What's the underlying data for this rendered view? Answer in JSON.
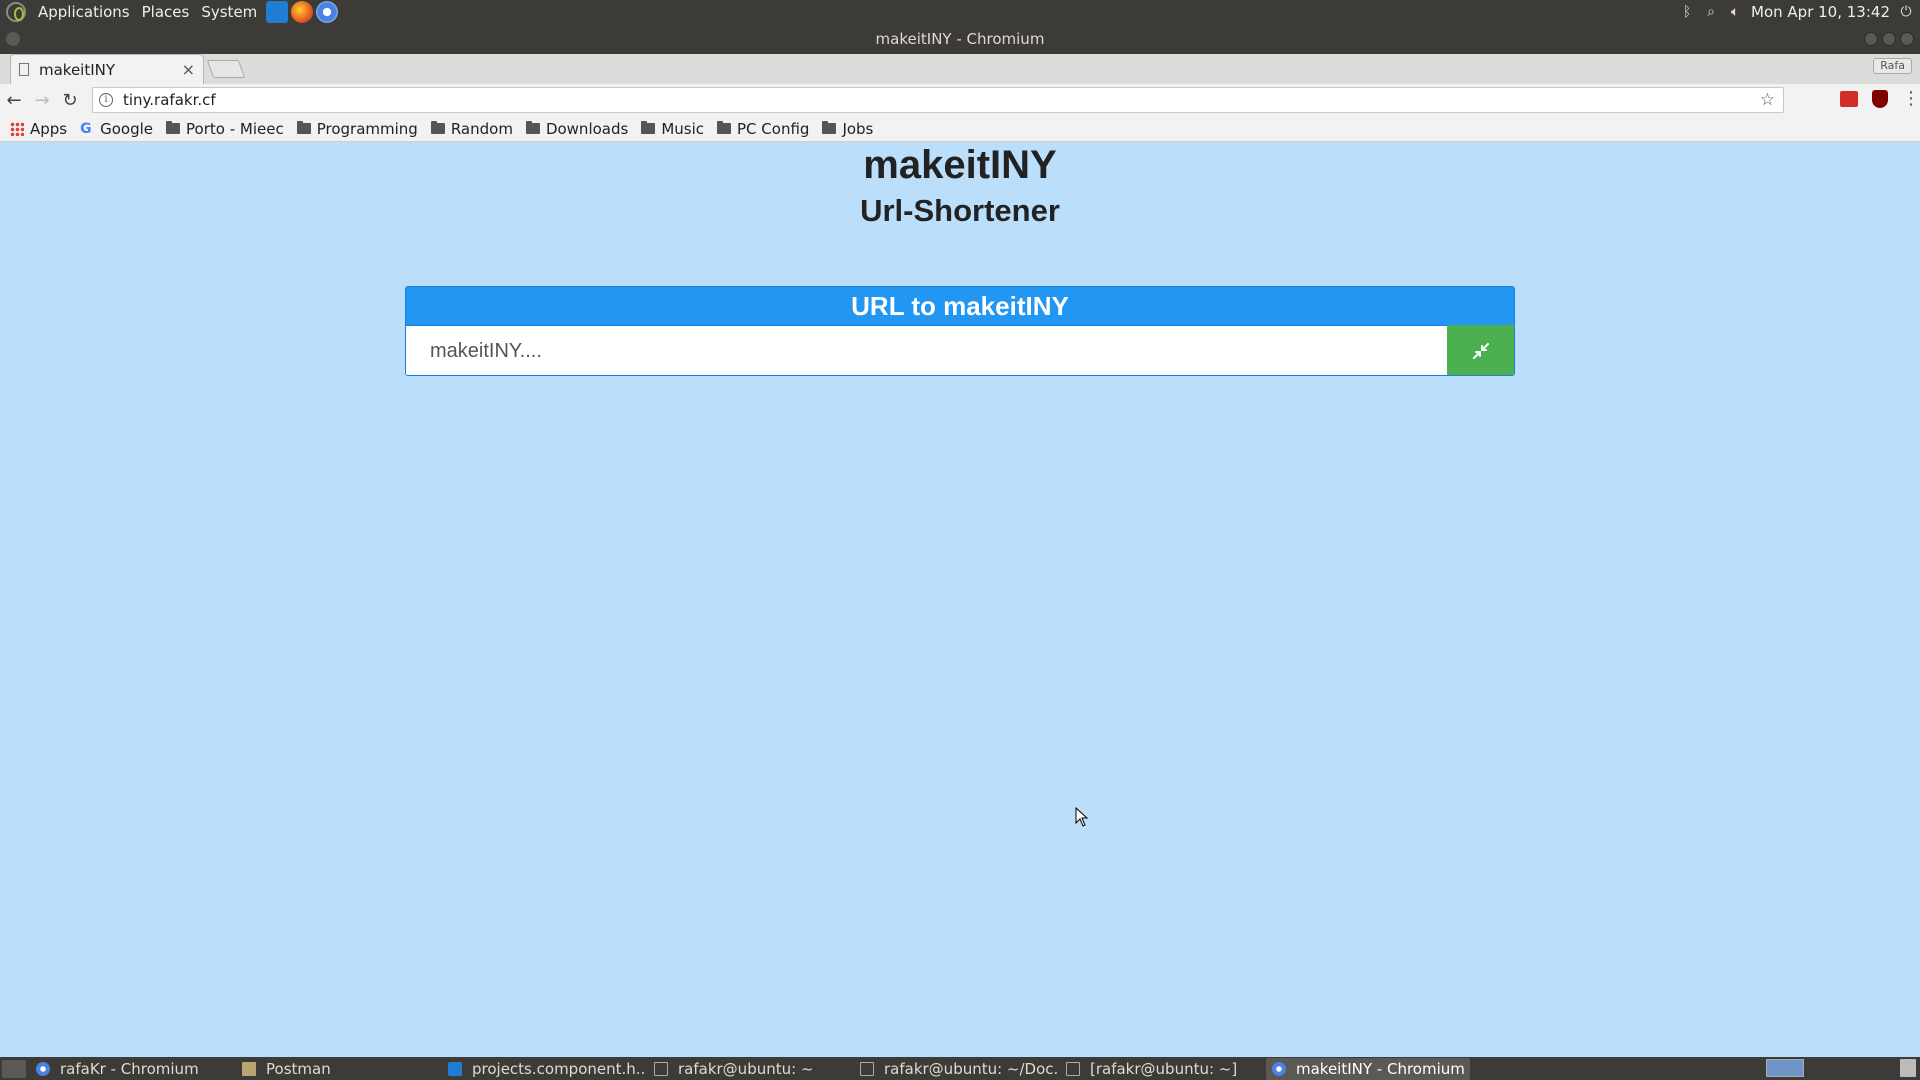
{
  "top_panel": {
    "menus": [
      "Applications",
      "Places",
      "System"
    ],
    "launchers": [
      "vscode-icon",
      "firefox-icon",
      "chromium-icon"
    ],
    "clock": "Mon Apr 10, 13:42"
  },
  "window": {
    "title": "makeitINY - Chromium"
  },
  "browser": {
    "tab_title": "makeitINY",
    "tab_close": "×",
    "profile_name": "Rafa",
    "url": "tiny.rafakr.cf",
    "bookmarks": [
      {
        "label": "Apps",
        "icon": "apps-grid-icon"
      },
      {
        "label": "Google",
        "icon": "google-icon"
      },
      {
        "label": "Porto - Mieec",
        "icon": "folder-icon"
      },
      {
        "label": "Programming",
        "icon": "folder-icon"
      },
      {
        "label": "Random",
        "icon": "folder-icon"
      },
      {
        "label": "Downloads",
        "icon": "folder-icon"
      },
      {
        "label": "Music",
        "icon": "folder-icon"
      },
      {
        "label": "PC Config",
        "icon": "folder-icon"
      },
      {
        "label": "Jobs",
        "icon": "folder-icon"
      }
    ]
  },
  "page": {
    "title": "makeitINY",
    "subtitle": "Url-Shortener",
    "card_header": "URL to makeitINY",
    "input_placeholder": "makeitINY....",
    "input_value": "",
    "accent_color": "#2196f3",
    "button_color": "#4caf50",
    "background_color": "#bbdefb"
  },
  "taskbar": {
    "tasks": [
      {
        "label": "rafaKr - Chromium",
        "icon": "chromium-icon",
        "active": false
      },
      {
        "label": "Postman",
        "icon": "folder-icon",
        "active": false
      },
      {
        "label": "projects.component.h...",
        "icon": "vscode-icon",
        "active": false
      },
      {
        "label": "rafakr@ubuntu: ~",
        "icon": "terminal-icon",
        "active": false
      },
      {
        "label": "rafakr@ubuntu: ~/Doc...",
        "icon": "terminal-icon",
        "active": false
      },
      {
        "label": "[rafakr@ubuntu: ~]",
        "icon": "terminal-icon",
        "active": false
      },
      {
        "label": "makeitINY - Chromium",
        "icon": "chromium-icon",
        "active": true
      }
    ]
  }
}
